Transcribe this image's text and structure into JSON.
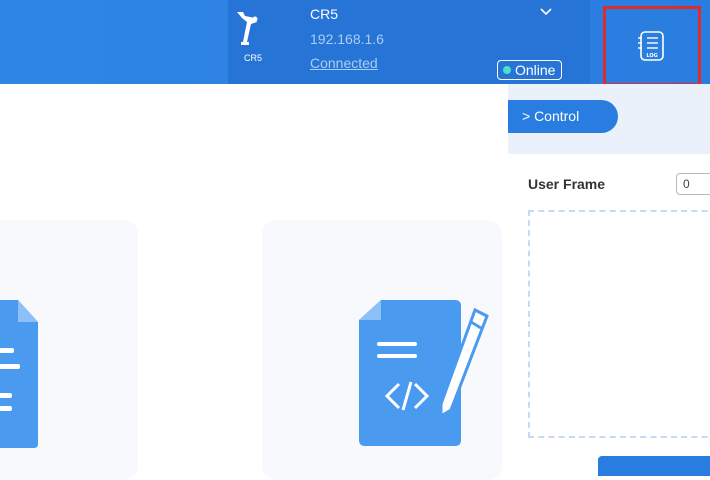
{
  "header": {
    "robot_model_small": "CR5",
    "robot_name": "CR5",
    "robot_ip": "192.168.1.6",
    "connection_link": "Connected",
    "status_badge": "Online",
    "log_button_text": "LOG"
  },
  "right_panel": {
    "control_tab": "> Control",
    "user_frame_label": "User Frame",
    "user_frame_value": "0"
  },
  "colors": {
    "topbar": "#2a7de0",
    "robot_panel": "#2674d6",
    "highlight_border": "#e02b2b",
    "online_dot": "#4ee0c6",
    "doc_icon": "#4a9bf0"
  }
}
